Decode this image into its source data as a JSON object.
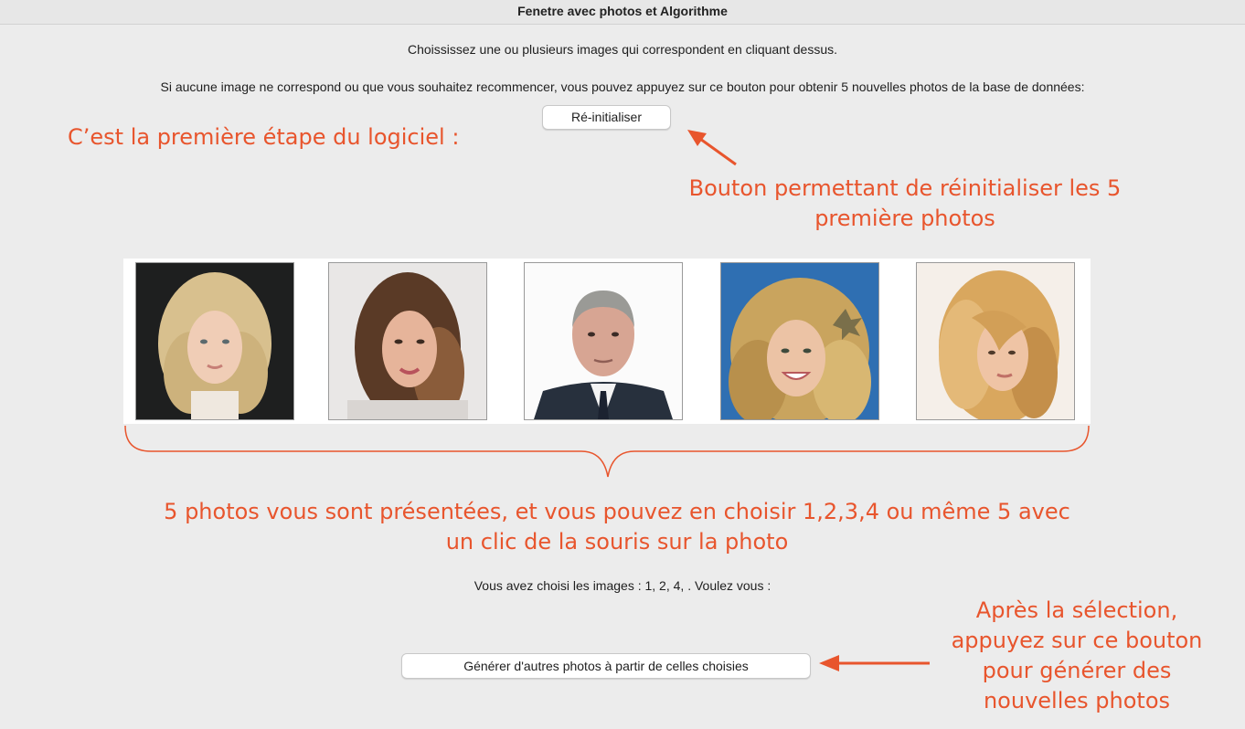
{
  "window": {
    "title": "Fenetre avec photos et  Algorithme"
  },
  "instructions": {
    "choose": "Choississez une ou plusieurs images qui correspondent en cliquant dessus.",
    "reset_hint": "Si aucune image ne correspond ou que vous souhaitez recommencer, vous pouvez appuyez sur ce bouton pour obtenir 5 nouvelles photos de la base de données:"
  },
  "buttons": {
    "reset_label": "Ré-initialiser",
    "generate_label": "Générer d'autres photos à partir de celles choisies"
  },
  "status": {
    "selection_text": "Vous avez choisi les images : 1, 2, 4, . Voulez vous :"
  },
  "annotations": {
    "step_title": "C’est la première étape du logiciel :",
    "reset_callout": {
      "line1": "Bouton permettant de réinitialiser les 5",
      "line2": "première photos"
    },
    "photos_callout": {
      "line1": "5 photos vous sont présentées, et vous pouvez en choisir 1,2,3,4 ou même 5 avec",
      "line2": "un clic de la souris sur la photo"
    },
    "generate_callout": {
      "line1": "Après la sélection,",
      "line2": "appuyez sur ce bouton",
      "line3": "pour générer des",
      "line4": "nouvelles photos"
    },
    "color": "#e8552d"
  },
  "photos": [
    {
      "index": 1,
      "subject": "blonde-woman-curly-hair",
      "background": "#1e1f1f",
      "hair": "#d8c08e",
      "skin": "#f0cdb6"
    },
    {
      "index": 2,
      "subject": "brunette-woman-long-hair",
      "background": "#e9e7e6",
      "hair": "#5a3a26",
      "skin": "#e6b49a"
    },
    {
      "index": 3,
      "subject": "older-man-suit",
      "background": "#fbfbfb",
      "hair": "#9a9a96",
      "skin": "#d7a593"
    },
    {
      "index": 4,
      "subject": "blonde-woman-blue-background",
      "background": "#2f6fb2",
      "hair": "#c9a45e",
      "skin": "#ecc3a5"
    },
    {
      "index": 5,
      "subject": "blonde-woman-long-hair",
      "background": "#f5efe9",
      "hair": "#d9a75e",
      "skin": "#efc4a5"
    }
  ]
}
